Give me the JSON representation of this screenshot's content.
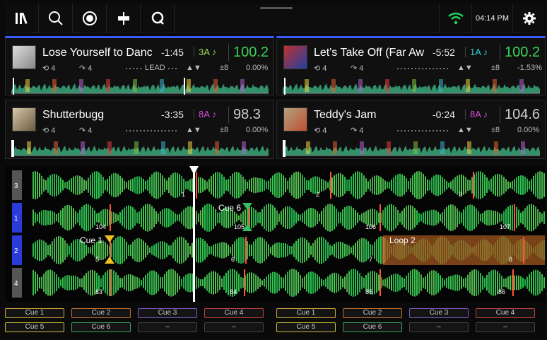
{
  "topbar": {
    "time": "04:14 PM",
    "buttons": [
      {
        "name": "library-icon",
        "label": "library"
      },
      {
        "name": "search-icon",
        "label": "search"
      },
      {
        "name": "record-icon",
        "label": "record"
      },
      {
        "name": "split-view-icon",
        "label": "split"
      },
      {
        "name": "q-icon",
        "label": "Q"
      }
    ],
    "colors": {
      "wifi": "#22d35a"
    }
  },
  "decks": [
    {
      "title": "Lose Yourself to Danc",
      "time": "-1:45",
      "key": "3A",
      "key_color": "#9bd95a",
      "bpm": "100.2",
      "bpm_color": "#3bd45a",
      "loop": "4",
      "beat": "4",
      "lead": "LEAD",
      "pitch_range": "±8",
      "pitch": "0.00%",
      "active": true
    },
    {
      "title": "Let's Take Off (Far Aw",
      "time": "-5:52",
      "key": "1A",
      "key_color": "#2bd4d4",
      "bpm": "100.2",
      "bpm_color": "#3bd45a",
      "loop": "4",
      "beat": "4",
      "lead": "",
      "pitch_range": "±8",
      "pitch": "-1.53%",
      "active": true
    },
    {
      "title": "Shutterbugg",
      "time": "-3:35",
      "key": "8A",
      "key_color": "#d44fd6",
      "bpm": "98.3",
      "bpm_color": "#cccccc",
      "loop": "4",
      "beat": "4",
      "lead": "",
      "pitch_range": "±8",
      "pitch": "0.00%",
      "active": false
    },
    {
      "title": "Teddy's Jam",
      "time": "-0:24",
      "key": "8A",
      "key_color": "#d44fd6",
      "bpm": "104.6",
      "bpm_color": "#cccccc",
      "loop": "4",
      "beat": "4",
      "lead": "",
      "pitch_range": "±8",
      "pitch": "0.00%",
      "active": false
    }
  ],
  "lanes": [
    {
      "label": "3",
      "color": "#555555"
    },
    {
      "label": "1",
      "color": "#2b3bd9"
    },
    {
      "label": "2",
      "color": "#2b3bd9"
    },
    {
      "label": "4",
      "color": "#555555"
    }
  ],
  "markers": {
    "cue6": "Cue 6",
    "cue1": "Cue 1",
    "loop2": "Loop 2",
    "beats3": [
      "1",
      "2",
      "3"
    ],
    "beats1": [
      "104",
      "105",
      "106",
      "107"
    ],
    "beats2": [
      "5",
      "6",
      "7",
      "8"
    ],
    "beats4": [
      "83",
      "84",
      "85",
      "86"
    ]
  },
  "pads_left": [
    {
      "label": "Cue 1",
      "color": "#caa43a"
    },
    {
      "label": "Cue 2",
      "color": "#c07030"
    },
    {
      "label": "Cue 3",
      "color": "#7c58c0"
    },
    {
      "label": "Cue 4",
      "color": "#c04040"
    },
    {
      "label": "Cue 5",
      "color": "#c8c040"
    },
    {
      "label": "Cue 6",
      "color": "#40a060"
    },
    {
      "label": "–",
      "color": "#444444"
    },
    {
      "label": "–",
      "color": "#444444"
    }
  ],
  "pads_right": [
    {
      "label": "Cue 1",
      "color": "#caa43a"
    },
    {
      "label": "Cue 2",
      "color": "#c07030"
    },
    {
      "label": "Cue 3",
      "color": "#7c58c0"
    },
    {
      "label": "Cue 4",
      "color": "#c04040"
    },
    {
      "label": "Cue 5",
      "color": "#c8c040"
    },
    {
      "label": "Cue 6",
      "color": "#40a060"
    },
    {
      "label": "–",
      "color": "#444444"
    },
    {
      "label": "–",
      "color": "#444444"
    }
  ]
}
